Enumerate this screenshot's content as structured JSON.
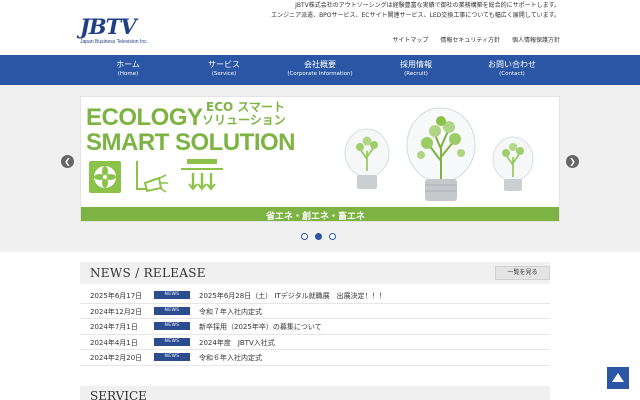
{
  "header": {
    "logo_text": "JBTV",
    "logo_sub": "Japan Business Television Inc.",
    "tagline_line1": "JBTV株式会社のアウトソーシングは経験豊富な実績で御社の業務構築を総合的にサポートします。",
    "tagline_line2": "エンジニア派遣、BPOサービス、ECサイト関連サービス、LED交換工事についても幅広く展開しています。",
    "links": [
      "サイトマップ",
      "情報セキュリティ方針",
      "個人情報保護方針"
    ]
  },
  "nav": {
    "items": [
      {
        "jp": "ホーム",
        "en": "(Home)"
      },
      {
        "jp": "サービス",
        "en": "(Service)"
      },
      {
        "jp": "会社概要",
        "en": "(Corporate Information)"
      },
      {
        "jp": "採用情報",
        "en": "(Recruit)"
      },
      {
        "jp": "お問い合わせ",
        "en": "(Contact)"
      }
    ]
  },
  "slider": {
    "title_line1": "ECOLOGY",
    "title_line2": "SMART SOLUTION",
    "jp_line1": "ECO スマート",
    "jp_line2": "ソリューション",
    "strip": "省エネ・創エネ・畜エネ",
    "active_dot": 1,
    "dot_count": 3
  },
  "news": {
    "title": "NEWS / RELEASE",
    "more_label": "一覧を見る",
    "badge": "NEWS",
    "rows": [
      {
        "date": "2025年6月17日",
        "text": "2025年6月28日（土） ITデジタル就職展　出展決定！！！"
      },
      {
        "date": "2024年12月2日",
        "text": "令和７年入社内定式"
      },
      {
        "date": "2024年7月1日",
        "text": "新卒採用（2025年卒）の募集について"
      },
      {
        "date": "2024年4月1日",
        "text": "2024年度　JBTV入社式"
      },
      {
        "date": "2024年2月20日",
        "text": "令和６年入社内定式"
      }
    ]
  },
  "service": {
    "title": "SERVICE"
  },
  "colors": {
    "nav_blue": "#2b56a5",
    "eco_green": "#7cb342",
    "badge_navy": "#2b4d8f"
  }
}
